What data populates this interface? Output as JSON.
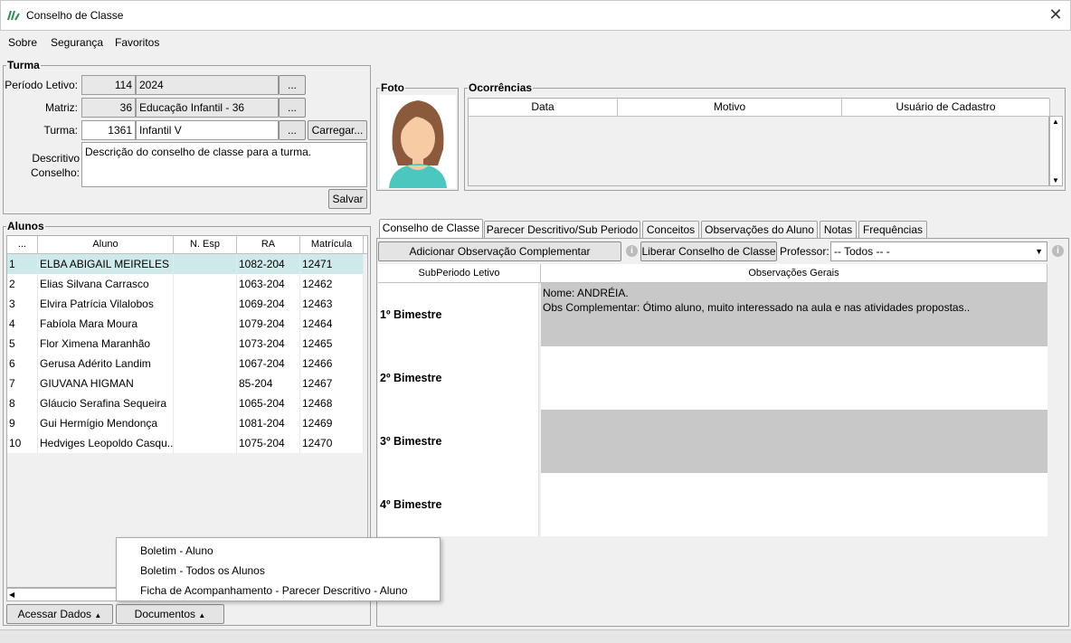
{
  "window": {
    "title": "Conselho de Classe",
    "close": "✕"
  },
  "menu": [
    "Sobre",
    "Segurança",
    "Favoritos"
  ],
  "turma": {
    "legend": "Turma",
    "periodo_label": "Período Letivo:",
    "periodo_code": "114",
    "periodo_value": "2024",
    "matriz_label": "Matriz:",
    "matriz_code": "36",
    "matriz_value": "Educação Infantil - 36",
    "turma_label": "Turma:",
    "turma_code": "1361",
    "turma_value": "Infantil V",
    "lookup_label": "...",
    "carregar_label": "Carregar...",
    "descritivo_label_1": "Descritivo",
    "descritivo_label_2": "Conselho:",
    "descritivo_value": "Descrição do conselho de classe para a turma.",
    "salvar_label": "Salvar"
  },
  "foto": {
    "legend": "Foto"
  },
  "ocorrencias": {
    "legend": "Ocorrências",
    "columns": [
      "Data",
      "Motivo",
      "Usuário de Cadastro"
    ]
  },
  "alunos": {
    "legend": "Alunos",
    "columns": [
      "...",
      "Aluno",
      "N. Esp",
      "RA",
      "Matrícula"
    ],
    "rows": [
      {
        "n": "1",
        "nome": "ELBA ABIGAIL MEIRELES",
        "ra": "1082-204",
        "mat": "12471"
      },
      {
        "n": "2",
        "nome": "Elias Silvana Carrasco",
        "ra": "1063-204",
        "mat": "12462"
      },
      {
        "n": "3",
        "nome": "Elvira Patrícia Vilalobos",
        "ra": "1069-204",
        "mat": "12463"
      },
      {
        "n": "4",
        "nome": "Fabíola Mara Moura",
        "ra": "1079-204",
        "mat": "12464"
      },
      {
        "n": "5",
        "nome": "Flor Ximena Maranhão",
        "ra": "1073-204",
        "mat": "12465"
      },
      {
        "n": "6",
        "nome": "Gerusa Adérito Landim",
        "ra": "1067-204",
        "mat": "12466"
      },
      {
        "n": "7",
        "nome": "GIUVANA HIGMAN",
        "ra": "85-204",
        "mat": "12467"
      },
      {
        "n": "8",
        "nome": "Gláucio Serafina Sequeira",
        "ra": "1065-204",
        "mat": "12468"
      },
      {
        "n": "9",
        "nome": "Gui Hermígio Mendonça",
        "ra": "1081-204",
        "mat": "12469"
      },
      {
        "n": "10",
        "nome": "Hedviges Leopoldo Casqu...",
        "ra": "1075-204",
        "mat": "12470"
      }
    ],
    "acessar_label": "Acessar Dados",
    "documentos_label": "Documentos"
  },
  "tabs": [
    "Conselho de Classe",
    "Parecer Descritivo/Sub Periodo",
    "Conceitos",
    "Observações do Aluno",
    "Notas",
    "Frequências"
  ],
  "conselho": {
    "add_obs_label": "Adicionar Observação Complementar",
    "liberar_label": "Liberar Conselho de Classe",
    "professor_label": "Professor:",
    "professor_value": "-- Todos -- -",
    "col_periodo": "SubPeriodo Letivo",
    "col_obs": "Observações Gerais",
    "rows": [
      {
        "periodo": "1º Bimestre",
        "line1": "Nome: ANDRÉIA.",
        "line2": "Obs Complementar: Ótimo aluno, muito interessado na aula e nas atividades propostas.."
      },
      {
        "periodo": "2º Bimestre",
        "line1": "",
        "line2": ""
      },
      {
        "periodo": "3º Bimestre",
        "line1": "",
        "line2": ""
      },
      {
        "periodo": "4º Bimestre",
        "line1": "",
        "line2": ""
      }
    ]
  },
  "popup_menu": [
    "Boletim - Aluno",
    "Boletim - Todos os Alunos",
    "Ficha de Acompanhamento - Parecer Descritivo - Aluno"
  ]
}
